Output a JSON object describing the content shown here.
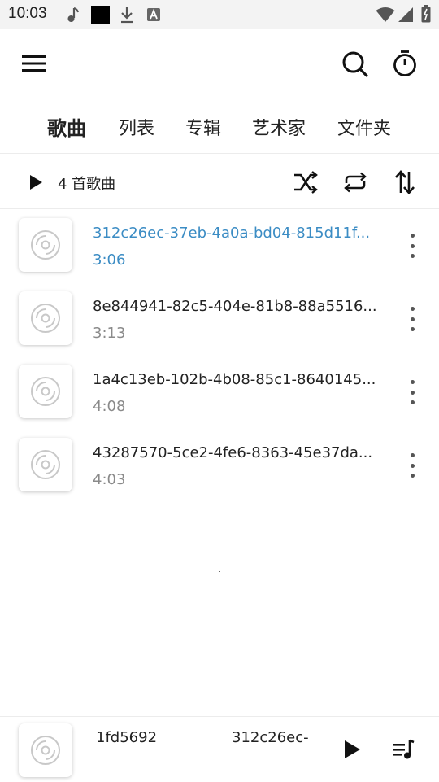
{
  "status_bar": {
    "time": "10:03",
    "icons": [
      "music-note-icon",
      "black-square-icon",
      "download-icon",
      "text-box-icon",
      "wifi-icon",
      "signal-icon",
      "battery-icon"
    ]
  },
  "top_bar": {
    "icons": [
      "menu-icon",
      "search-icon",
      "timer-icon"
    ]
  },
  "tabs": [
    {
      "label": "歌曲",
      "active": true
    },
    {
      "label": "列表",
      "active": false
    },
    {
      "label": "专辑",
      "active": false
    },
    {
      "label": "艺术家",
      "active": false
    },
    {
      "label": "文件夹",
      "active": false
    }
  ],
  "controls": {
    "count_label": "4 首歌曲",
    "icons": [
      "play-icon",
      "shuffle-icon",
      "repeat-icon",
      "sort-icon"
    ]
  },
  "songs": [
    {
      "title": "312c26ec-37eb-4a0a-bd04-815d11f...",
      "duration": "3:06",
      "playing": true
    },
    {
      "title": "8e844941-82c5-404e-81b8-88a5516...",
      "duration": "3:13",
      "playing": false
    },
    {
      "title": "1a4c13eb-102b-4b08-85c1-8640145...",
      "duration": "4:08",
      "playing": false
    },
    {
      "title": "43287570-5ce2-4fe6-8363-45e37da...",
      "duration": "4:03",
      "playing": false
    }
  ],
  "mini_player": {
    "text_left": "1fd5692",
    "text_right": "312c26ec-",
    "icons": [
      "play-icon",
      "queue-icon"
    ]
  },
  "colors": {
    "accent": "#3b8cc4",
    "secondary_text": "#8a8a8a",
    "status_bar_bg": "#f3f3f3"
  }
}
